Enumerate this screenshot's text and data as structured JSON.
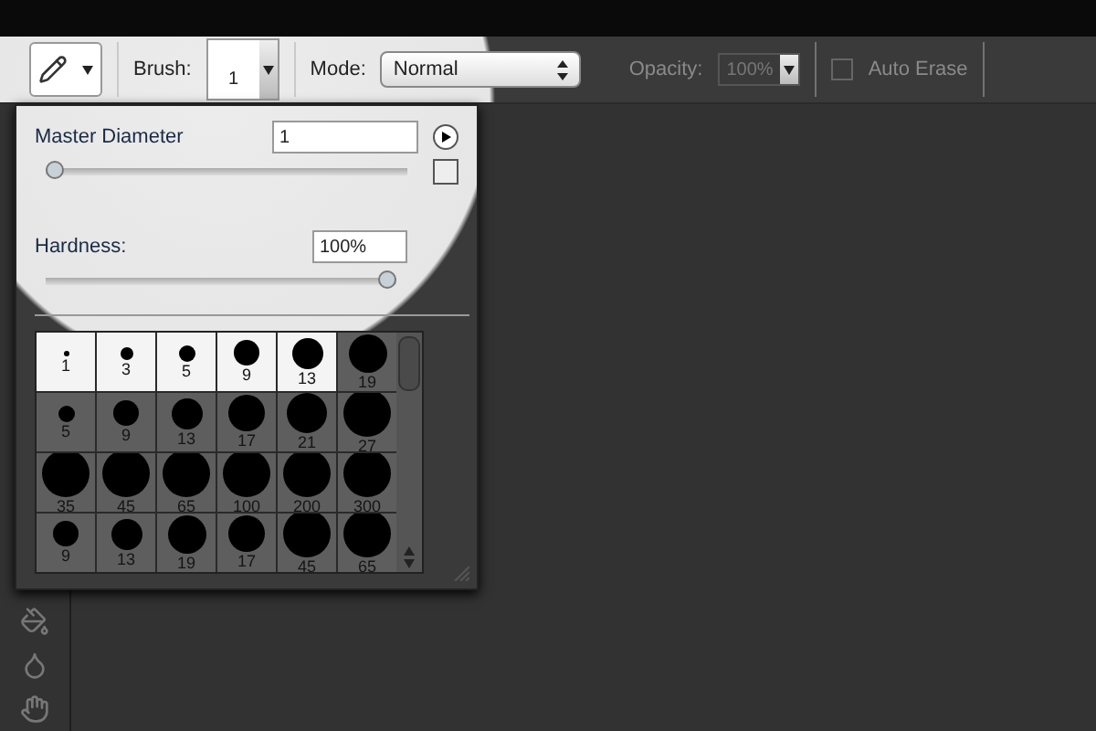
{
  "toolbar": {
    "brush": {
      "label": "Brush:",
      "size": "1"
    },
    "mode": {
      "label": "Mode:",
      "value": "Normal"
    },
    "opacity": {
      "label": "Opacity:",
      "value": "100%"
    },
    "auto_erase": {
      "label": "Auto Erase",
      "checked": false
    }
  },
  "brush_panel": {
    "master_diameter": {
      "label": "Master Diameter",
      "value": "1",
      "level": 0
    },
    "hardness": {
      "label": "Hardness:",
      "value": "100%",
      "level": 1
    },
    "presets": [
      {
        "size": "1"
      },
      {
        "size": "3"
      },
      {
        "size": "5"
      },
      {
        "size": "9"
      },
      {
        "size": "13"
      },
      {
        "size": "19"
      },
      {
        "size": "5"
      },
      {
        "size": "9"
      },
      {
        "size": "13"
      },
      {
        "size": "17"
      },
      {
        "size": "21"
      },
      {
        "size": "27"
      },
      {
        "size": "35"
      },
      {
        "size": "45"
      },
      {
        "size": "65"
      },
      {
        "size": "100"
      },
      {
        "size": "200"
      },
      {
        "size": "300"
      },
      {
        "size": "9"
      },
      {
        "size": "13"
      },
      {
        "size": "19"
      },
      {
        "size": "17"
      },
      {
        "size": "45"
      },
      {
        "size": "65"
      }
    ]
  }
}
